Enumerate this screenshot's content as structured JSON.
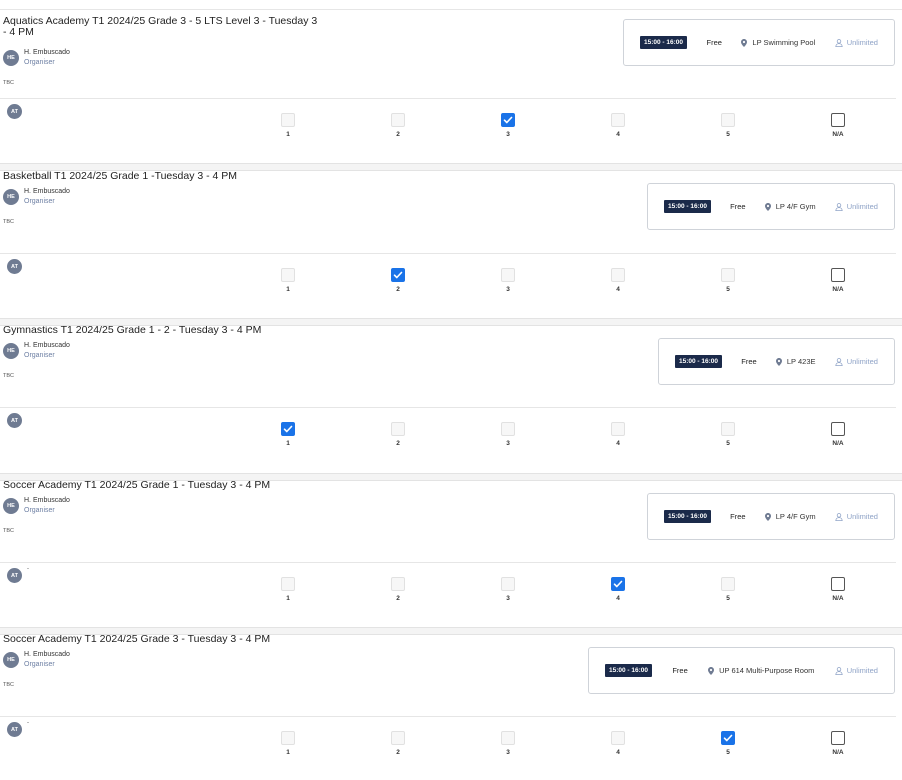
{
  "activities": [
    {
      "title": "Aquatics Academy T1 2024/25 Grade 3 - 5 LTS Level 3 - Tuesday 3 - 4 PM",
      "organiser_initials": "HE",
      "organiser_name": "H. Embuscado",
      "organiser_role": "Organiser",
      "note": "TBC",
      "time": "15:00 - 16:00",
      "price": "Free",
      "location": "LP Swimming Pool",
      "capacity": "Unlimited",
      "attendee_initials": "AT",
      "attendee_name": "",
      "options": [
        "1",
        "2",
        "3",
        "4",
        "5",
        "N/A"
      ],
      "selected": "3"
    },
    {
      "title": "Basketball T1 2024/25 Grade 1 -Tuesday 3 - 4 PM",
      "organiser_initials": "HE",
      "organiser_name": "H. Embuscado",
      "organiser_role": "Organiser",
      "note": "TBC",
      "time": "15:00 - 16:00",
      "price": "Free",
      "location": "LP 4/F Gym",
      "capacity": "Unlimited",
      "attendee_initials": "AT",
      "attendee_name": "",
      "options": [
        "1",
        "2",
        "3",
        "4",
        "5",
        "N/A"
      ],
      "selected": "2"
    },
    {
      "title": "Gymnastics T1 2024/25 Grade 1 - 2 - Tuesday 3 - 4 PM",
      "organiser_initials": "HE",
      "organiser_name": "H. Embuscado",
      "organiser_role": "Organiser",
      "note": "TBC",
      "time": "15:00 - 16:00",
      "price": "Free",
      "location": "LP 423E",
      "capacity": "Unlimited",
      "attendee_initials": "AT",
      "attendee_name": "",
      "options": [
        "1",
        "2",
        "3",
        "4",
        "5",
        "N/A"
      ],
      "selected": "1"
    },
    {
      "title": "Soccer Academy T1 2024/25 Grade 1 - Tuesday 3 - 4 PM",
      "organiser_initials": "HE",
      "organiser_name": "H. Embuscado",
      "organiser_role": "Organiser",
      "note": "TBC",
      "time": "15:00 - 16:00",
      "price": "Free",
      "location": "LP 4/F Gym",
      "capacity": "Unlimited",
      "attendee_initials": "AT",
      "attendee_name": "-",
      "options": [
        "1",
        "2",
        "3",
        "4",
        "5",
        "N/A"
      ],
      "selected": "4"
    },
    {
      "title": "Soccer Academy T1 2024/25 Grade 3 - Tuesday 3 - 4 PM",
      "organiser_initials": "HE",
      "organiser_name": "H. Embuscado",
      "organiser_role": "Organiser",
      "note": "TBC",
      "time": "15:00 - 16:00",
      "price": "Free",
      "location": "UP 614 Multi-Purpose Room",
      "capacity": "Unlimited",
      "attendee_initials": "AT",
      "attendee_name": "-",
      "options": [
        "1",
        "2",
        "3",
        "4",
        "5",
        "N/A"
      ],
      "selected": "5"
    }
  ],
  "icons": {
    "location": "map-pin-icon",
    "capacity": "person-icon",
    "checked": "checkmark-icon"
  },
  "colors": {
    "accent": "#1a73e8",
    "time_badge": "#1b2a4a",
    "avatar": "#6f7b92",
    "muted_blue": "#8fa3c7"
  }
}
